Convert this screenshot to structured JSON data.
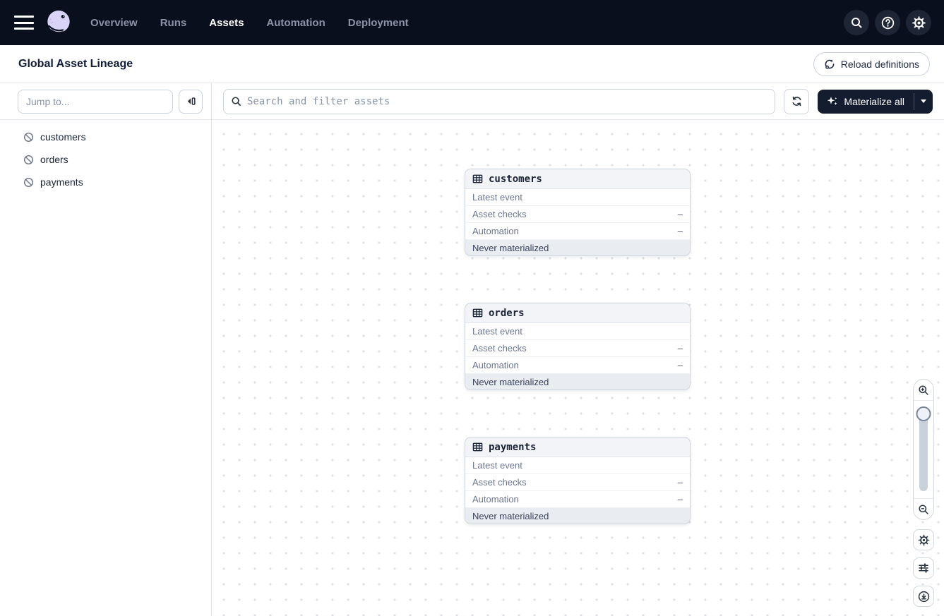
{
  "colors": {
    "nav_bg": "#0a0f1d",
    "nav_inactive_text": "#8b93a7",
    "nav_active_text": "#ffffff",
    "logo_lavender": "#d9d4f7",
    "materialize_button_bg": "#141c30",
    "node_header_bg": "#f2f4f7",
    "node_footer_bg": "#e9ecf1",
    "canvas_dot": "#dcdfe4"
  },
  "nav": {
    "items": [
      {
        "label": "Overview",
        "active": false
      },
      {
        "label": "Runs",
        "active": false
      },
      {
        "label": "Assets",
        "active": true
      },
      {
        "label": "Automation",
        "active": false
      },
      {
        "label": "Deployment",
        "active": false
      }
    ],
    "right_icons": [
      "search-icon",
      "help-icon",
      "settings-icon"
    ]
  },
  "header": {
    "title": "Global Asset Lineage",
    "reload_button_label": "Reload definitions"
  },
  "sidebar": {
    "jump_placeholder": "Jump to...",
    "assets": [
      "customers",
      "orders",
      "payments"
    ],
    "asset_status_icon": "never-materialized-slash-circle"
  },
  "toolbar": {
    "search_placeholder": "Search and filter assets",
    "materialize_label": "Materialize all"
  },
  "canvas": {
    "nodes": [
      {
        "title": "customers",
        "rows": [
          {
            "label": "Latest event",
            "value": ""
          },
          {
            "label": "Asset checks",
            "value": "–"
          },
          {
            "label": "Automation",
            "value": "–"
          }
        ],
        "footer": "Never materialized"
      },
      {
        "title": "orders",
        "rows": [
          {
            "label": "Latest event",
            "value": ""
          },
          {
            "label": "Asset checks",
            "value": "–"
          },
          {
            "label": "Automation",
            "value": "–"
          }
        ],
        "footer": "Never materialized"
      },
      {
        "title": "payments",
        "rows": [
          {
            "label": "Latest event",
            "value": ""
          },
          {
            "label": "Asset checks",
            "value": "–"
          },
          {
            "label": "Automation",
            "value": "–"
          }
        ],
        "footer": "Never materialized"
      }
    ],
    "controls": [
      "zoom-in",
      "zoom-slider",
      "zoom-out",
      "settings",
      "filters",
      "download"
    ]
  }
}
